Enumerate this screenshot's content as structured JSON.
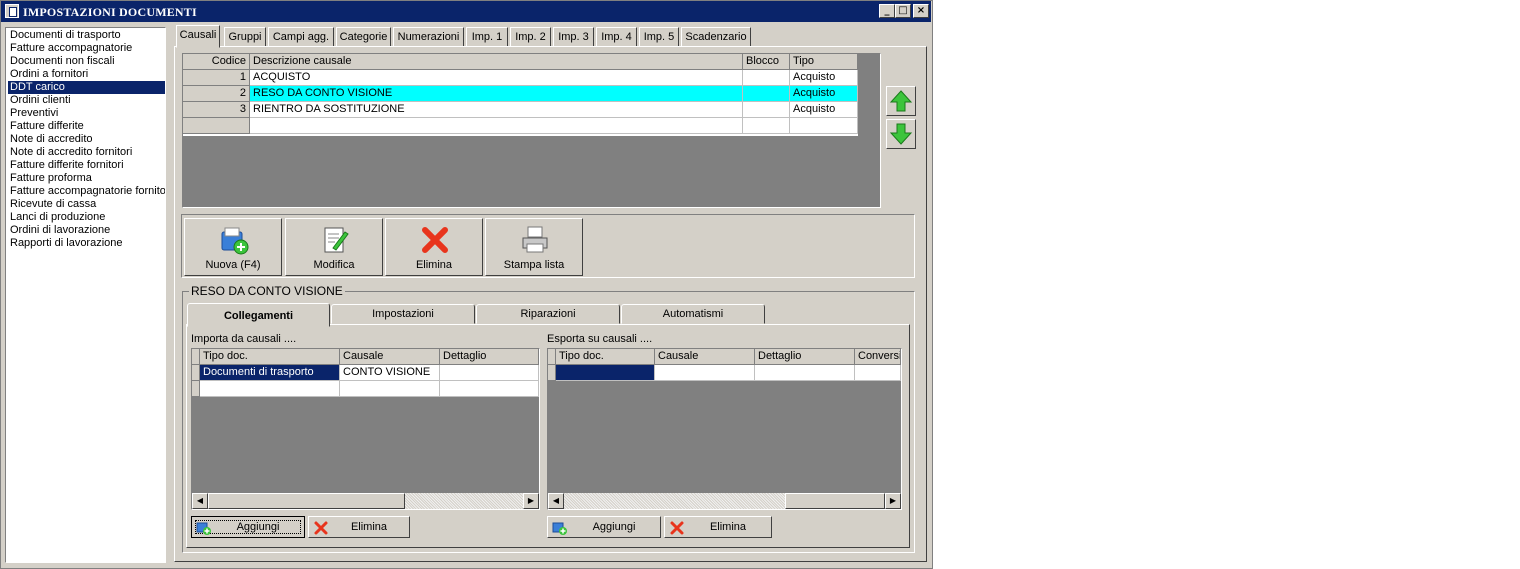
{
  "window": {
    "title": "IMPOSTAZIONI DOCUMENTI"
  },
  "doc_types": [
    "Documenti di trasporto",
    "Fatture accompagnatorie",
    "Documenti non fiscali",
    "Ordini a fornitori",
    "DDT carico",
    "Ordini clienti",
    "Preventivi",
    "Fatture differite",
    "Note di accredito",
    "Note di accredito fornitori",
    "Fatture differite fornitori",
    "Fatture proforma",
    "Fatture accompagnatorie fornitori",
    "Ricevute di cassa",
    "Lanci di produzione",
    "Ordini di lavorazione",
    "Rapporti di lavorazione"
  ],
  "selected_doc_type": "DDT carico",
  "tabs": [
    "Causali",
    "Gruppi",
    "Campi agg.",
    "Categorie",
    "Numerazioni",
    "Imp. 1",
    "Imp. 2",
    "Imp. 3",
    "Imp. 4",
    "Imp. 5",
    "Scadenzario"
  ],
  "active_tab": "Causali",
  "causali_table": {
    "headers": {
      "codice": "Codice",
      "descrizione": "Descrizione causale",
      "blocco": "Blocco",
      "tipo": "Tipo"
    },
    "rows": [
      {
        "codice": "1",
        "descrizione": "ACQUISTO",
        "blocco": "",
        "tipo": "Acquisto"
      },
      {
        "codice": "2",
        "descrizione": "RESO DA CONTO VISIONE",
        "blocco": "",
        "tipo": "Acquisto"
      },
      {
        "codice": "3",
        "descrizione": "RIENTRO DA SOSTITUZIONE",
        "blocco": "",
        "tipo": "Acquisto"
      }
    ],
    "selected_row_color": "#00ffff"
  },
  "toolbar": {
    "nuova": "Nuova (F4)",
    "modifica": "Modifica",
    "elimina": "Elimina",
    "stampa": "Stampa lista"
  },
  "details": {
    "title": "RESO DA CONTO VISIONE",
    "subtabs": [
      "Collegamenti",
      "Impostazioni",
      "Riparazioni",
      "Automatismi"
    ],
    "active_subtab": "Collegamenti",
    "importa": {
      "label": "Importa da causali ....",
      "headers": [
        "Tipo doc.",
        "Causale",
        "Dettaglio"
      ],
      "rows": [
        {
          "tipo": "Documenti di trasporto",
          "causale": "CONTO VISIONE",
          "dettaglio": ""
        }
      ],
      "add_label": "Aggiungi",
      "delete_label": "Elimina"
    },
    "esporta": {
      "label": "Esporta su causali ....",
      "headers": [
        "Tipo doc.",
        "Causale",
        "Dettaglio",
        "Conversi"
      ],
      "add_label": "Aggiungi",
      "delete_label": "Elimina"
    }
  },
  "colors": {
    "title_bar": "#0a246a",
    "selection": "#0a246a",
    "face": "#d4d0c8",
    "grid_bg": "#808080"
  }
}
